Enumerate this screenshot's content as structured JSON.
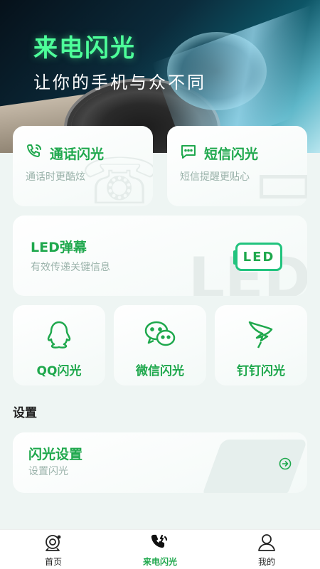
{
  "hero": {
    "title": "来电闪光",
    "subtitle": "让你的手机与众不同"
  },
  "cards": {
    "call": {
      "title": "通话闪光",
      "subtitle": "通话时更酷炫",
      "icon": "phone-call-icon"
    },
    "sms": {
      "title": "短信闪光",
      "subtitle": "短信提醒更贴心",
      "icon": "message-icon"
    },
    "led": {
      "title": "LED弹幕",
      "subtitle": "有效传递关键信息",
      "badge": "LED",
      "icon": "led-icon"
    },
    "qq": {
      "title": "QQ闪光",
      "icon": "qq-icon"
    },
    "wechat": {
      "title": "微信闪光",
      "icon": "wechat-icon"
    },
    "dingtalk": {
      "title": "钉钉闪光",
      "icon": "dingtalk-icon"
    }
  },
  "settings": {
    "section_title": "设置",
    "flash": {
      "title": "闪光设置",
      "subtitle": "设置闪光",
      "icon": "arrow-right-circle-icon"
    }
  },
  "tabbar": {
    "items": [
      {
        "label": "首页",
        "icon": "camera-icon",
        "active": false
      },
      {
        "label": "来电闪光",
        "icon": "phone-flash-icon",
        "active": true
      },
      {
        "label": "我的",
        "icon": "user-icon",
        "active": false
      }
    ]
  },
  "colors": {
    "accent": "#1fa84d",
    "accent_bright": "#4dff9a",
    "subtext": "#9bb3ab",
    "background": "#eef5f3"
  }
}
